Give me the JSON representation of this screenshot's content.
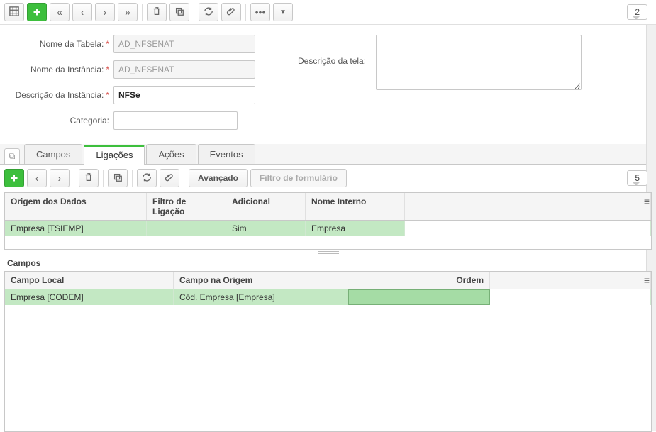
{
  "topToolbar": {
    "count": "2"
  },
  "form": {
    "labels": {
      "nomeTabela": "Nome da Tabela:",
      "nomeInstancia": "Nome da Instância:",
      "descInstancia": "Descrição da Instância:",
      "categoria": "Categoria:",
      "descTela": "Descrição da tela:"
    },
    "values": {
      "nomeTabela": "AD_NFSENAT",
      "nomeInstancia": "AD_NFSENAT",
      "descInstancia": "NFSe",
      "categoria": "",
      "descTela": ""
    }
  },
  "tabs": [
    "Campos",
    "Ligações",
    "Ações",
    "Eventos"
  ],
  "activeTab": 1,
  "subToolbar": {
    "avancado": "Avançado",
    "filtroPlaceholder": "Filtro de formulário",
    "count": "5"
  },
  "grid1": {
    "headers": [
      "Origem dos Dados",
      "Filtro de Ligação",
      "Adicional",
      "Nome Interno"
    ],
    "row": [
      "Empresa [TSIEMP]",
      "",
      "Sim",
      "Empresa"
    ]
  },
  "section2Title": "Campos",
  "grid2": {
    "headers": [
      "Campo Local",
      "Campo na Origem",
      "Ordem"
    ],
    "row": [
      "Empresa [CODEM]",
      "Cód. Empresa [Empresa]",
      ""
    ]
  }
}
